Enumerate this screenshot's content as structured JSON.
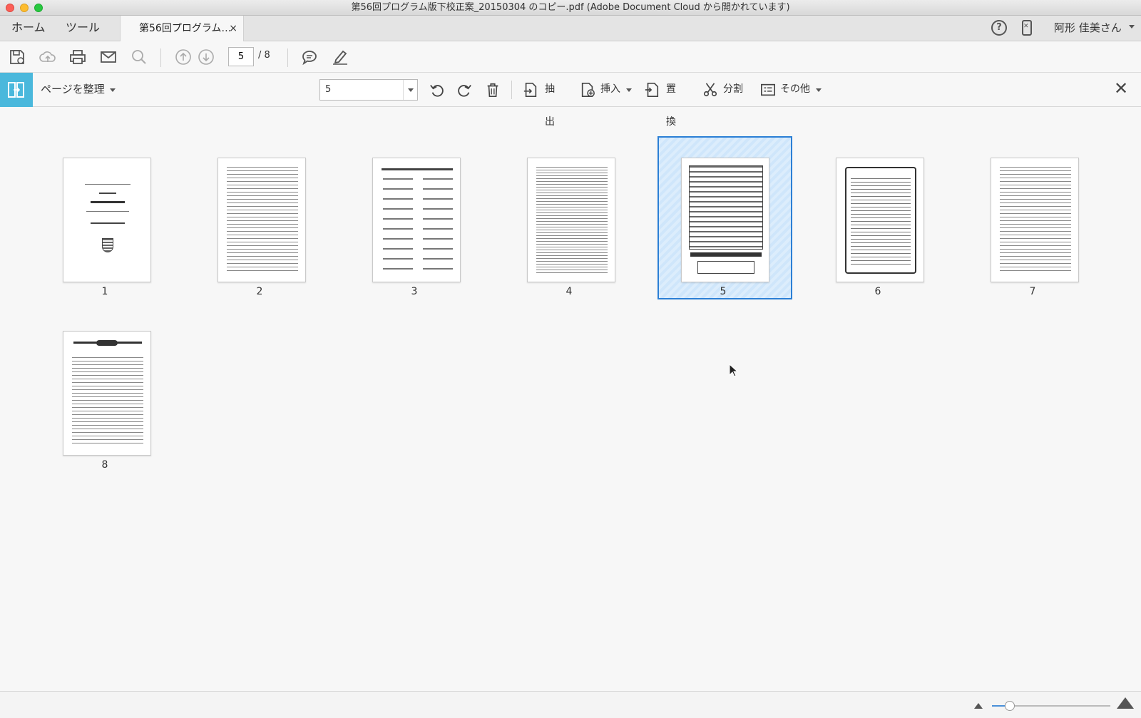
{
  "window": {
    "title": "第56回プログラム版下校正案_20150304 のコピー.pdf (Adobe Document Cloud から開かれています)"
  },
  "tabs": {
    "home": "ホーム",
    "tools": "ツール",
    "document": "第56回プログラム…",
    "document_close": "×"
  },
  "account": {
    "help_icon": "help-icon",
    "mobile_icon": "mobile-link-icon",
    "user_name": "阿形 佳美さん"
  },
  "toolbar": {
    "icons": [
      "save-icon",
      "upload-icon",
      "print-icon",
      "mail-icon",
      "search-icon",
      "page-up-icon",
      "page-down-icon",
      "comment-icon",
      "highlight-pen-icon"
    ],
    "current_page": "5",
    "total_pages": "/ 8"
  },
  "organize": {
    "title": "ページを整理",
    "page_range": "5",
    "extract": "抽出",
    "insert": "挿入",
    "replace": "置換",
    "split": "分割",
    "more": "その他",
    "close": "✕"
  },
  "pages": {
    "labels": [
      "1",
      "2",
      "3",
      "4",
      "5",
      "6",
      "7",
      "8"
    ],
    "selected": "5"
  },
  "zoom": {
    "level": 0.15
  },
  "colors": {
    "accent": "#4ab8dc",
    "selection_border": "#2b7fd5",
    "selection_fill": "#d5e9fb"
  }
}
